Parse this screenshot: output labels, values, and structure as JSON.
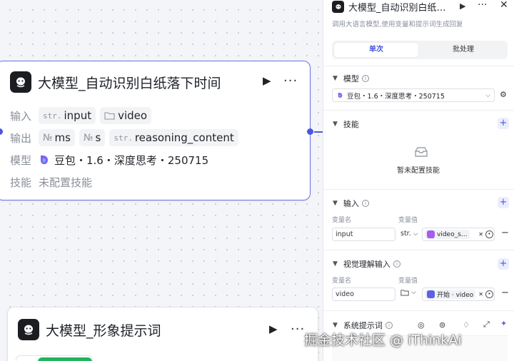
{
  "canvas": {
    "node1": {
      "title": "大模型_自动识别白纸落下时间",
      "run_icon": "▶",
      "more_icon": "···",
      "input_label": "输入",
      "inputs": [
        {
          "type": "str.",
          "name": "input"
        },
        {
          "type": "folder",
          "name": "video"
        }
      ],
      "output_label": "输出",
      "outputs": [
        {
          "type": "№",
          "name": "ms"
        },
        {
          "type": "№",
          "name": "s"
        },
        {
          "type": "str.",
          "name": "reasoning_content"
        }
      ],
      "model_label": "模型",
      "model_value": "豆包・1.6・深度思考・250715",
      "skill_label": "技能",
      "skill_value": "未配置技能"
    },
    "node2": {
      "title": "大模型_形象提示词",
      "run_icon": "▶",
      "more_icon": "···"
    }
  },
  "panel": {
    "title": "大模型_自动识别白纸…",
    "description": "调用大语言模型,使用变量和提示词生成回复",
    "tabs": [
      {
        "label": "单次",
        "active": true
      },
      {
        "label": "批处理",
        "active": false
      }
    ],
    "model_section": {
      "title": "模型",
      "selected": "豆包・1.6・深度思考・250715"
    },
    "skill_section": {
      "title": "技能",
      "empty_text": "暂未配置技能"
    },
    "input_section": {
      "title": "输入",
      "name_header": "变量名",
      "value_header": "变量值",
      "rows": [
        {
          "name": "input",
          "type": "str.",
          "value": "video_s…"
        }
      ]
    },
    "visual_section": {
      "title": "视觉理解输入",
      "name_header": "变量名",
      "value_header": "变量值",
      "rows": [
        {
          "name": "video",
          "type": "folder",
          "value": "开始 · video"
        }
      ]
    },
    "system_prompt_section": {
      "title": "系统提示词"
    }
  },
  "watermark": "掘金技术社区 @ iThinkAi",
  "colors": {
    "accent": "#4b56e0",
    "selected_border": "#6b74e8",
    "node_logo": "#1c1d21"
  }
}
